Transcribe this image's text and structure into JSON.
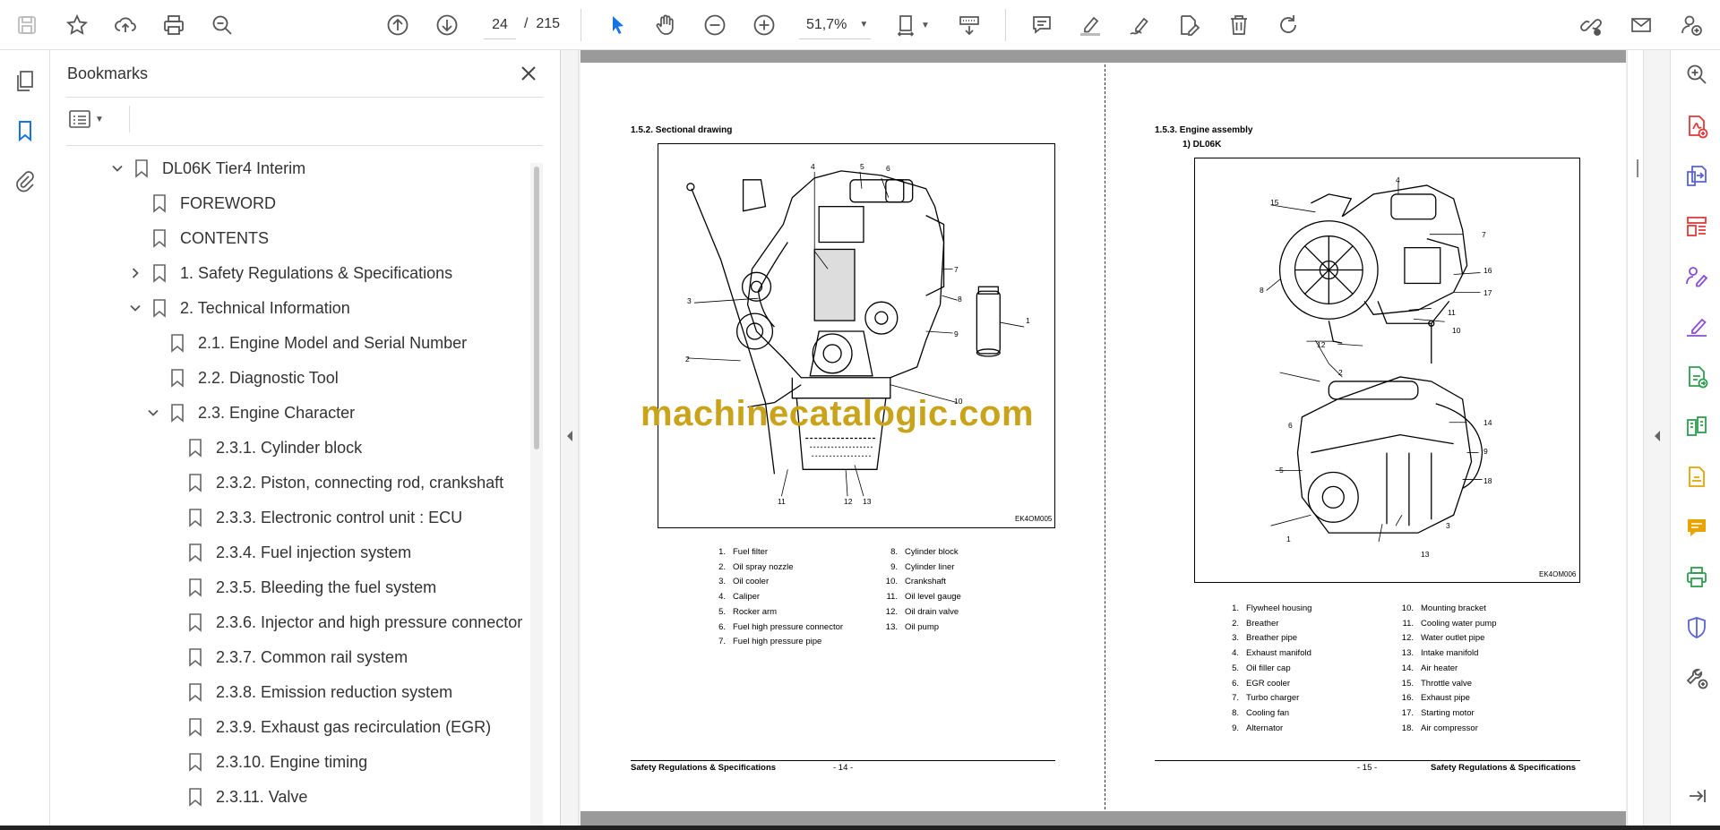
{
  "toolbar": {
    "page_current": "24",
    "page_separator": "/",
    "page_total": "215",
    "zoom": "51,7%"
  },
  "bookmarks_panel": {
    "title": "Bookmarks",
    "items": [
      {
        "label": "DL06K Tier4 Interim",
        "level": 0,
        "state": "expanded"
      },
      {
        "label": "FOREWORD",
        "level": 1,
        "state": "leaf"
      },
      {
        "label": "CONTENTS",
        "level": 1,
        "state": "leaf"
      },
      {
        "label": "1. Safety Regulations & Specifications",
        "level": 1,
        "state": "collapsed"
      },
      {
        "label": "2. Technical Information",
        "level": 1,
        "state": "expanded"
      },
      {
        "label": "2.1. Engine Model and Serial Number",
        "level": 2,
        "state": "leaf"
      },
      {
        "label": "2.2. Diagnostic Tool",
        "level": 2,
        "state": "leaf"
      },
      {
        "label": "2.3. Engine Character",
        "level": 2,
        "state": "expanded"
      },
      {
        "label": "2.3.1. Cylinder block",
        "level": 3,
        "state": "leaf"
      },
      {
        "label": "2.3.2. Piston, connecting rod, crankshaft",
        "level": 3,
        "state": "leaf"
      },
      {
        "label": "2.3.3. Electronic control unit : ECU",
        "level": 3,
        "state": "leaf"
      },
      {
        "label": "2.3.4. Fuel injection system",
        "level": 3,
        "state": "leaf"
      },
      {
        "label": "2.3.5. Bleeding the fuel system",
        "level": 3,
        "state": "leaf"
      },
      {
        "label": "2.3.6. Injector and high pressure connector",
        "level": 3,
        "state": "leaf"
      },
      {
        "label": "2.3.7. Common rail system",
        "level": 3,
        "state": "leaf"
      },
      {
        "label": "2.3.8. Emission reduction system",
        "level": 3,
        "state": "leaf"
      },
      {
        "label": "2.3.9. Exhaust gas recirculation (EGR)",
        "level": 3,
        "state": "leaf"
      },
      {
        "label": "2.3.10. Engine timing",
        "level": 3,
        "state": "leaf"
      },
      {
        "label": "2.3.11. Valve",
        "level": 3,
        "state": "leaf"
      }
    ]
  },
  "left_page": {
    "section_title": "1.5.2. Sectional drawing",
    "figure_code": "EK4OM005",
    "callouts": [
      "1",
      "2",
      "3",
      "4",
      "5",
      "6",
      "7",
      "8",
      "9",
      "10",
      "11",
      "12",
      "13"
    ],
    "legend_col1": [
      {
        "n": "1.",
        "t": "Fuel filter"
      },
      {
        "n": "2.",
        "t": "Oil spray nozzle"
      },
      {
        "n": "3.",
        "t": "Oil cooler"
      },
      {
        "n": "4.",
        "t": "Caliper"
      },
      {
        "n": "5.",
        "t": "Rocker arm"
      },
      {
        "n": "6.",
        "t": "Fuel high pressure connector"
      },
      {
        "n": "7.",
        "t": "Fuel high pressure pipe"
      }
    ],
    "legend_col2": [
      {
        "n": "8.",
        "t": "Cylinder block"
      },
      {
        "n": "9.",
        "t": "Cylinder liner"
      },
      {
        "n": "10.",
        "t": "Crankshaft"
      },
      {
        "n": "11.",
        "t": "Oil level gauge"
      },
      {
        "n": "12.",
        "t": "Oil drain valve"
      },
      {
        "n": "13.",
        "t": "Oil pump"
      }
    ],
    "footer_text": "Safety Regulations & Specifications",
    "footer_page": "- 14 -"
  },
  "right_page": {
    "section_title": "1.5.3. Engine assembly",
    "subtitle": "1)  DL06K",
    "figure_code": "EK4OM006",
    "callouts_top": [
      "15",
      "4",
      "7",
      "16",
      "17",
      "8",
      "11",
      "10",
      "12"
    ],
    "callouts_bottom": [
      "2",
      "14",
      "6",
      "9",
      "5",
      "18",
      "1",
      "3",
      "13"
    ],
    "legend_col1": [
      {
        "n": "1.",
        "t": "Flywheel housing"
      },
      {
        "n": "2.",
        "t": "Breather"
      },
      {
        "n": "3.",
        "t": "Breather pipe"
      },
      {
        "n": "4.",
        "t": "Exhaust manifold"
      },
      {
        "n": "5.",
        "t": "Oil filler cap"
      },
      {
        "n": "6.",
        "t": "EGR cooler"
      },
      {
        "n": "7.",
        "t": "Turbo charger"
      },
      {
        "n": "8.",
        "t": "Cooling fan"
      },
      {
        "n": "9.",
        "t": "Alternator"
      }
    ],
    "legend_col2": [
      {
        "n": "10.",
        "t": "Mounting bracket"
      },
      {
        "n": "11.",
        "t": "Cooling water pump"
      },
      {
        "n": "12.",
        "t": "Water outlet pipe"
      },
      {
        "n": "13.",
        "t": "Intake manifold"
      },
      {
        "n": "14.",
        "t": "Air heater"
      },
      {
        "n": "15.",
        "t": "Throttle valve"
      },
      {
        "n": "16.",
        "t": "Exhaust pipe"
      },
      {
        "n": "17.",
        "t": "Starting motor"
      },
      {
        "n": "18.",
        "t": "Air compressor"
      }
    ],
    "footer_page": "- 15 -",
    "footer_text": "Safety Regulations & Specifications"
  },
  "watermark": "machinecatalogic.com",
  "colors": {
    "accent_blue": "#1473e6",
    "watermark": "#c9a31a",
    "icon_gray": "#555555",
    "pdf_red": "#e23a3a",
    "pdf_purple": "#8a4cd8",
    "pdf_green": "#2e9e4f",
    "pdf_yellow": "#e8a400"
  }
}
